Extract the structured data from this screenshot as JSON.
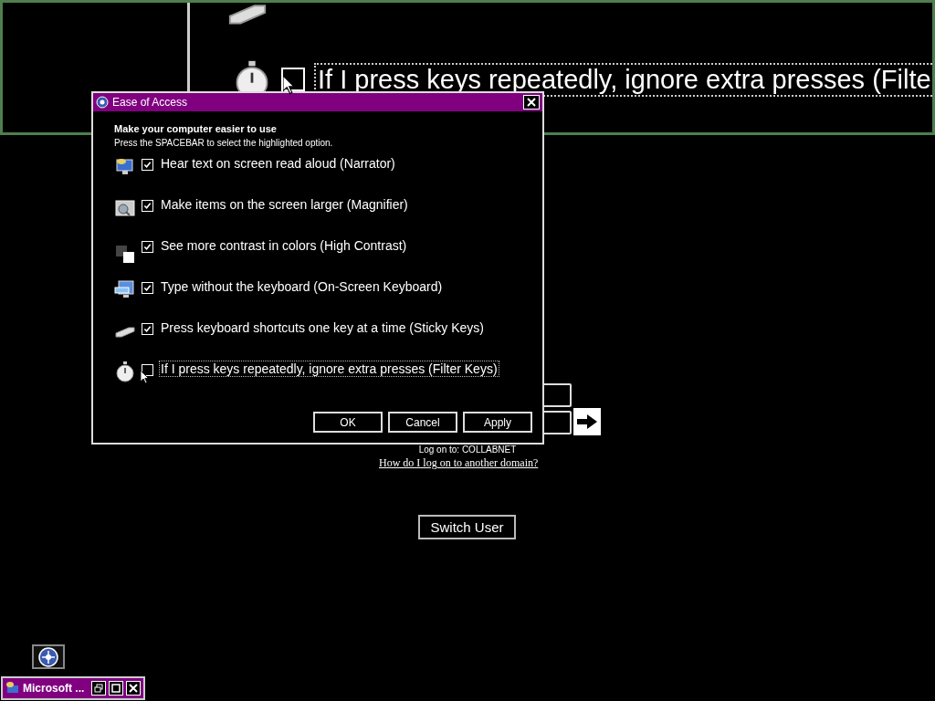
{
  "magnifier": {
    "option": {
      "label": "If I press keys repeatedly, ignore extra presses (Filte",
      "checked": false,
      "focused": true
    }
  },
  "logon": {
    "domain_text": "Log on to: COLLABNET",
    "help_link": "How do I log on to another domain?",
    "switch_user": "Switch User"
  },
  "dialog": {
    "title": "Ease of Access",
    "heading": "Make your computer easier to use",
    "instruction": "Press the SPACEBAR to select the highlighted option.",
    "options": [
      {
        "kind": "narrator",
        "label": "Hear text on screen read aloud (Narrator)",
        "checked": true,
        "focused": false
      },
      {
        "kind": "magnifier",
        "label": "Make items on the screen larger (Magnifier)",
        "checked": true,
        "focused": false
      },
      {
        "kind": "contrast",
        "label": "See more contrast in colors (High Contrast)",
        "checked": true,
        "focused": false
      },
      {
        "kind": "keyboard",
        "label": "Type without the keyboard (On-Screen Keyboard)",
        "checked": true,
        "focused": false
      },
      {
        "kind": "sticky",
        "label": "Press keyboard shortcuts one key at a time (Sticky Keys)",
        "checked": true,
        "focused": false
      },
      {
        "kind": "timer",
        "label": "If I press keys repeatedly, ignore extra presses (Filter Keys)",
        "checked": false,
        "focused": true
      }
    ],
    "buttons": [
      "OK",
      "Cancel",
      "Apply"
    ]
  },
  "minimized_window": {
    "title": "Microsoft ..."
  }
}
